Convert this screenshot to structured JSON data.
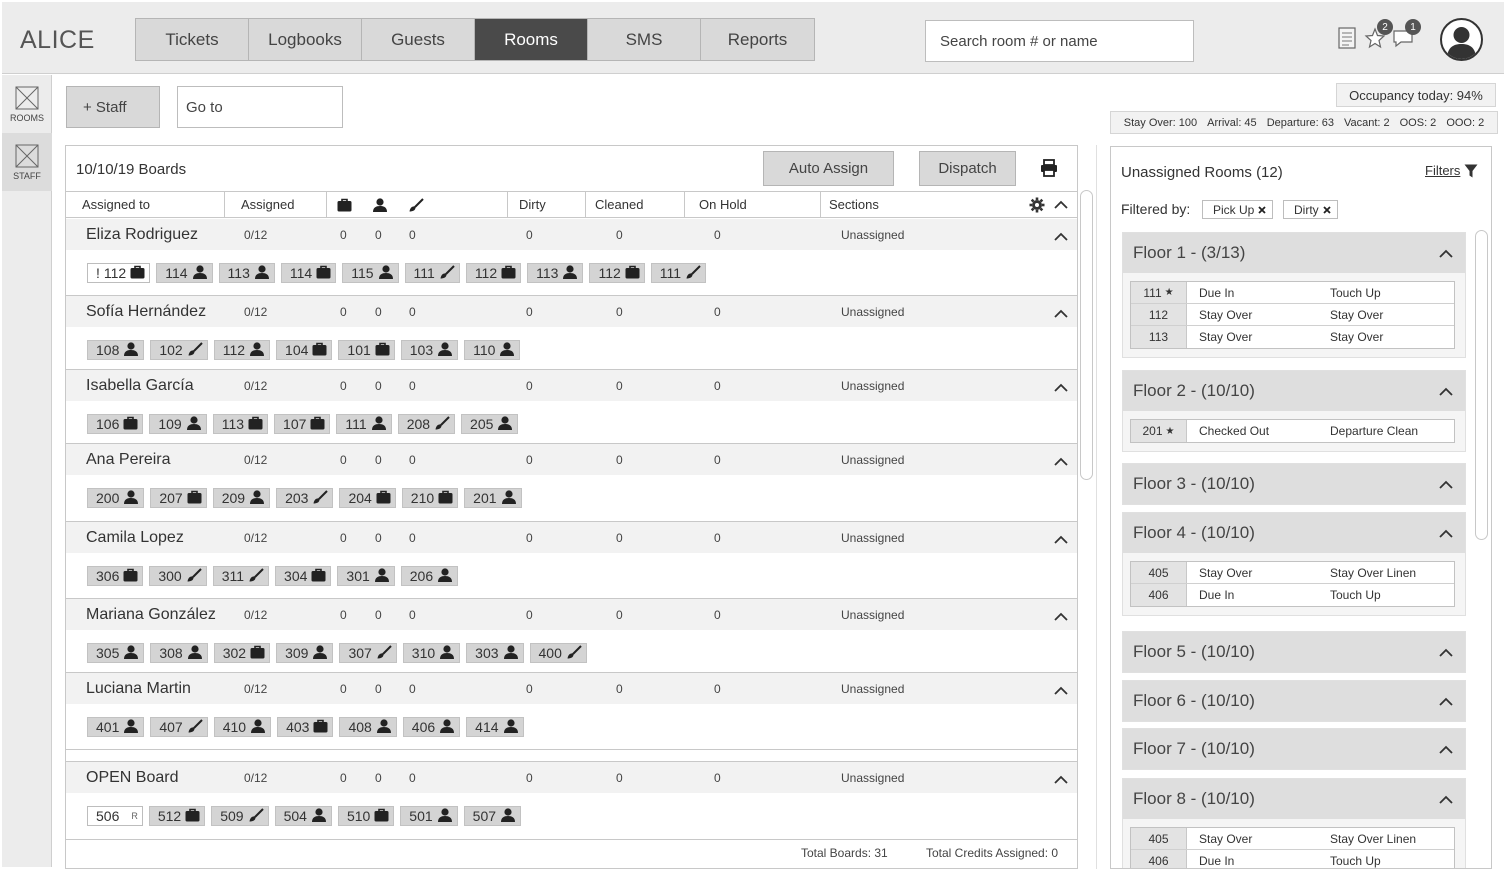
{
  "app": {
    "title": "ALICE"
  },
  "nav": {
    "tabs": [
      {
        "label": "Tickets",
        "active": false
      },
      {
        "label": "Logbooks",
        "active": false
      },
      {
        "label": "Guests",
        "active": false
      },
      {
        "label": "Rooms",
        "active": true
      },
      {
        "label": "SMS",
        "active": false
      },
      {
        "label": "Reports",
        "active": false
      }
    ]
  },
  "search": {
    "placeholder": "Search room # or name"
  },
  "notifications": {
    "alerts_count": "2",
    "messages_count": "1"
  },
  "rail": [
    {
      "label": "ROOMS",
      "icon": "image-placeholder-icon",
      "active": false
    },
    {
      "label": "STAFF",
      "icon": "image-placeholder-icon",
      "active": true
    }
  ],
  "actions": {
    "staff_label": "+ Staff",
    "goto_placeholder": "Go to"
  },
  "boards": {
    "title": "10/10/19 Boards",
    "auto_assign_label": "Auto Assign",
    "dispatch_label": "Dispatch",
    "columns": {
      "assigned_to": "Assigned to",
      "assigned": "Assigned",
      "dirty": "Dirty",
      "cleaned": "Cleaned",
      "on_hold": "On Hold",
      "sections": "Sections"
    },
    "rows": [
      {
        "name": "Eliza Rodriguez",
        "assigned": "0/12",
        "c1": "0",
        "c2": "0",
        "c3": "0",
        "dirty": "0",
        "cleaned": "0",
        "on_hold": "0",
        "section": "Unassigned",
        "rooms": [
          {
            "num": "112",
            "icon": "bag",
            "flag": "!",
            "outline": true
          },
          {
            "num": "114",
            "icon": "person"
          },
          {
            "num": "113",
            "icon": "person"
          },
          {
            "num": "114",
            "icon": "bag"
          },
          {
            "num": "115",
            "icon": "person"
          },
          {
            "num": "111",
            "icon": "brush"
          },
          {
            "num": "112",
            "icon": "bag"
          },
          {
            "num": "113",
            "icon": "person"
          },
          {
            "num": "112",
            "icon": "bag"
          },
          {
            "num": "111",
            "icon": "brush"
          }
        ]
      },
      {
        "name": "Sofía Hernández",
        "assigned": "0/12",
        "c1": "0",
        "c2": "0",
        "c3": "0",
        "dirty": "0",
        "cleaned": "0",
        "on_hold": "0",
        "section": "Unassigned",
        "rooms": [
          {
            "num": "108",
            "icon": "person"
          },
          {
            "num": "102",
            "icon": "brush"
          },
          {
            "num": "112",
            "icon": "person"
          },
          {
            "num": "104",
            "icon": "bag"
          },
          {
            "num": "101",
            "icon": "bag"
          },
          {
            "num": "103",
            "icon": "person"
          },
          {
            "num": "110",
            "icon": "person"
          }
        ]
      },
      {
        "name": "Isabella García",
        "assigned": "0/12",
        "c1": "0",
        "c2": "0",
        "c3": "0",
        "dirty": "0",
        "cleaned": "0",
        "on_hold": "0",
        "section": "Unassigned",
        "rooms": [
          {
            "num": "106",
            "icon": "bag"
          },
          {
            "num": "109",
            "icon": "person"
          },
          {
            "num": "113",
            "icon": "bag"
          },
          {
            "num": "107",
            "icon": "bag"
          },
          {
            "num": "111",
            "icon": "person"
          },
          {
            "num": "208",
            "icon": "brush"
          },
          {
            "num": "205",
            "icon": "person"
          }
        ]
      },
      {
        "name": "Ana Pereira",
        "assigned": "0/12",
        "c1": "0",
        "c2": "0",
        "c3": "0",
        "dirty": "0",
        "cleaned": "0",
        "on_hold": "0",
        "section": "Unassigned",
        "rooms": [
          {
            "num": "200",
            "icon": "person"
          },
          {
            "num": "207",
            "icon": "bag"
          },
          {
            "num": "209",
            "icon": "person"
          },
          {
            "num": "203",
            "icon": "brush"
          },
          {
            "num": "204",
            "icon": "bag"
          },
          {
            "num": "210",
            "icon": "bag"
          },
          {
            "num": "201",
            "icon": "person"
          }
        ]
      },
      {
        "name": "Camila Lopez",
        "assigned": "0/12",
        "c1": "0",
        "c2": "0",
        "c3": "0",
        "dirty": "0",
        "cleaned": "0",
        "on_hold": "0",
        "section": "Unassigned",
        "rooms": [
          {
            "num": "306",
            "icon": "bag"
          },
          {
            "num": "300",
            "icon": "brush"
          },
          {
            "num": "311",
            "icon": "brush"
          },
          {
            "num": "304",
            "icon": "bag"
          },
          {
            "num": "301",
            "icon": "person"
          },
          {
            "num": "206",
            "icon": "person"
          }
        ]
      },
      {
        "name": "Mariana González",
        "assigned": "0/12",
        "c1": "0",
        "c2": "0",
        "c3": "0",
        "dirty": "0",
        "cleaned": "0",
        "on_hold": "0",
        "section": "Unassigned",
        "rooms": [
          {
            "num": "305",
            "icon": "person"
          },
          {
            "num": "308",
            "icon": "person"
          },
          {
            "num": "302",
            "icon": "bag"
          },
          {
            "num": "309",
            "icon": "person"
          },
          {
            "num": "307",
            "icon": "brush"
          },
          {
            "num": "310",
            "icon": "person"
          },
          {
            "num": "303",
            "icon": "person"
          },
          {
            "num": "400",
            "icon": "brush"
          }
        ]
      },
      {
        "name": "Luciana Martin",
        "assigned": "0/12",
        "c1": "0",
        "c2": "0",
        "c3": "0",
        "dirty": "0",
        "cleaned": "0",
        "on_hold": "0",
        "section": "Unassigned",
        "rooms": [
          {
            "num": "401",
            "icon": "person"
          },
          {
            "num": "407",
            "icon": "brush"
          },
          {
            "num": "410",
            "icon": "person"
          },
          {
            "num": "403",
            "icon": "bag"
          },
          {
            "num": "408",
            "icon": "person"
          },
          {
            "num": "406",
            "icon": "person"
          },
          {
            "num": "414",
            "icon": "person"
          }
        ]
      },
      {
        "name": "OPEN Board",
        "assigned": "0/12",
        "c1": "0",
        "c2": "0",
        "c3": "0",
        "dirty": "0",
        "cleaned": "0",
        "on_hold": "0",
        "section": "Unassigned",
        "rooms": [
          {
            "num": "506",
            "icon": "none",
            "mark": "R",
            "outline": true
          },
          {
            "num": "512",
            "icon": "bag"
          },
          {
            "num": "509",
            "icon": "brush"
          },
          {
            "num": "504",
            "icon": "person"
          },
          {
            "num": "510",
            "icon": "bag"
          },
          {
            "num": "501",
            "icon": "person"
          },
          {
            "num": "507",
            "icon": "person"
          }
        ]
      }
    ],
    "footer": {
      "total_boards": "Total Boards: 31",
      "total_credits": "Total Credits Assigned: 0"
    }
  },
  "stats": {
    "occupancy": "Occupancy today: 94%",
    "items": [
      "Stay Over: 100",
      "Arrival: 45",
      "Departure: 63",
      "Vacant: 2",
      "OOS: 2",
      "OOO: 2"
    ]
  },
  "unassigned": {
    "title": "Unassigned Rooms (12)",
    "filters_label": "Filters",
    "filtered_by": "Filtered by:",
    "tags": [
      "Pick Up",
      "Dirty"
    ],
    "floors": [
      {
        "label": "Floor 1 -  (3/13)",
        "rooms": [
          {
            "num": "111",
            "star": true,
            "status": "Due In",
            "task": "Touch Up"
          },
          {
            "num": "112",
            "star": false,
            "status": "Stay Over",
            "task": "Stay Over"
          },
          {
            "num": "113",
            "star": false,
            "status": "Stay Over",
            "task": "Stay Over"
          }
        ]
      },
      {
        "label": "Floor 2 -  (10/10)",
        "rooms": [
          {
            "num": "201",
            "star": true,
            "status": "Checked Out",
            "task": "Departure Clean"
          }
        ]
      },
      {
        "label": "Floor 3 -  (10/10)",
        "rooms": []
      },
      {
        "label": "Floor 4 -  (10/10)",
        "rooms": [
          {
            "num": "405",
            "star": false,
            "status": "Stay Over",
            "task": "Stay Over Linen"
          },
          {
            "num": "406",
            "star": false,
            "status": "Due In",
            "task": "Touch Up"
          }
        ]
      },
      {
        "label": "Floor 5 -  (10/10)",
        "rooms": []
      },
      {
        "label": "Floor 6 -  (10/10)",
        "rooms": []
      },
      {
        "label": "Floor 7 -  (10/10)",
        "rooms": []
      },
      {
        "label": "Floor 8 -  (10/10)",
        "rooms": [
          {
            "num": "405",
            "star": false,
            "status": "Stay Over",
            "task": "Stay Over Linen"
          },
          {
            "num": "406",
            "star": false,
            "status": "Due In",
            "task": "Touch Up"
          }
        ]
      }
    ]
  }
}
